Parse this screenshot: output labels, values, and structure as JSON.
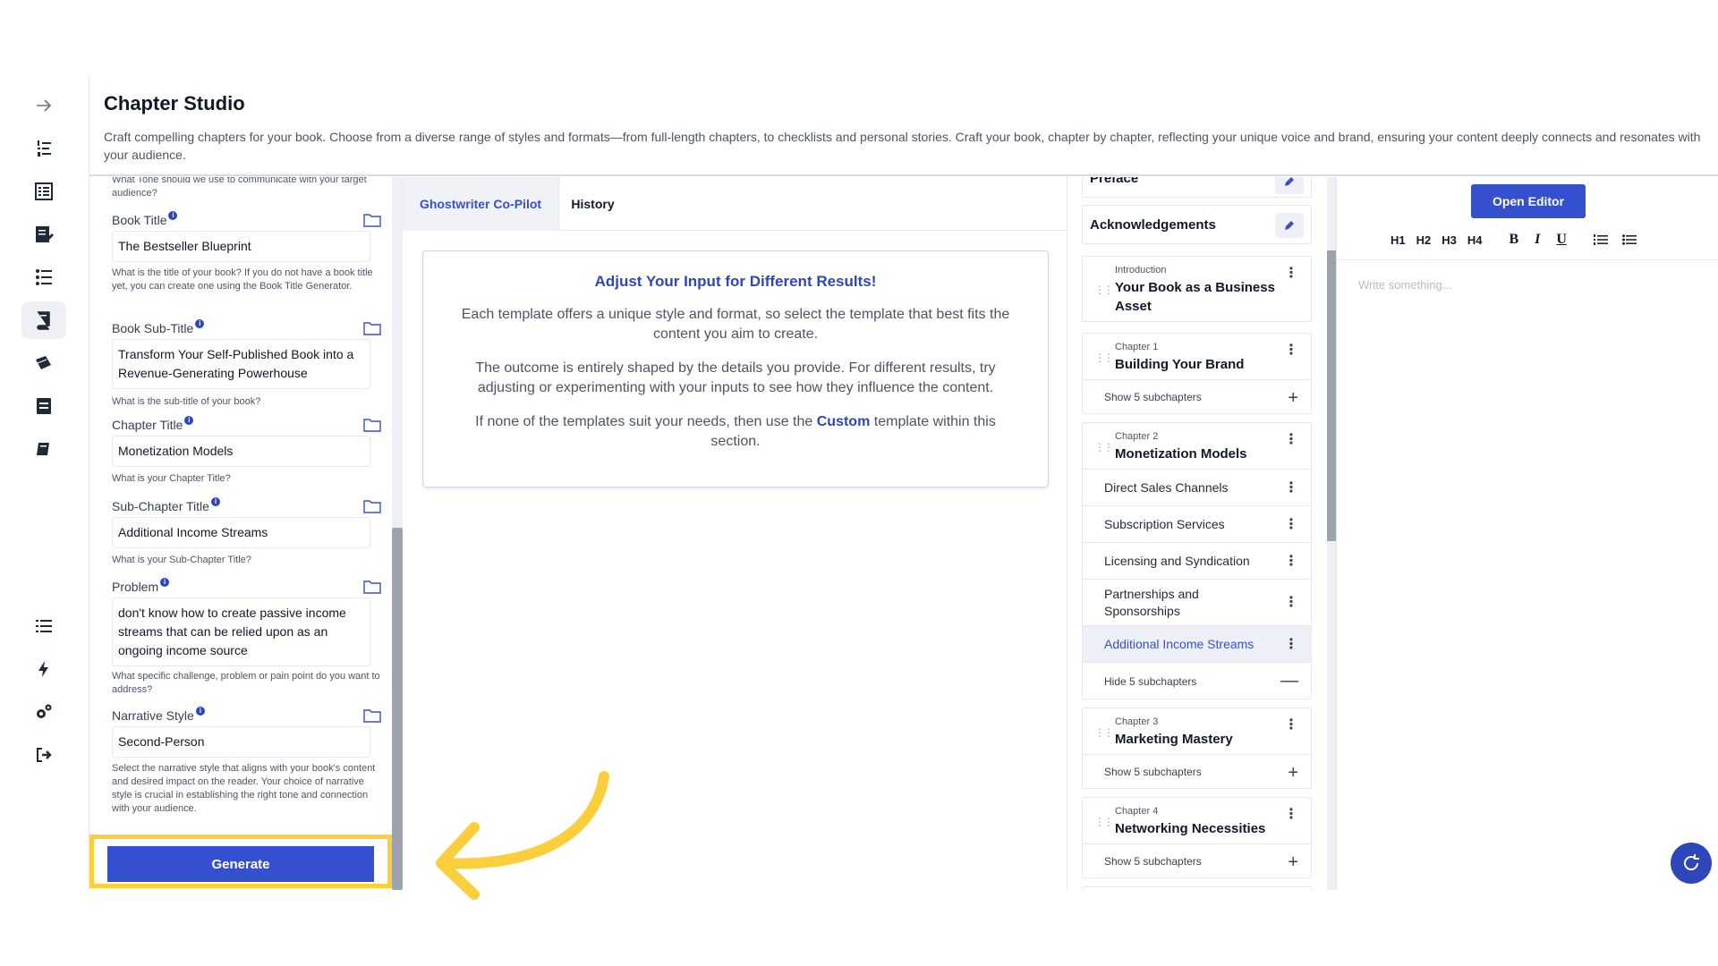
{
  "header": {
    "title": "Chapter Studio",
    "description": "Craft compelling chapters for your book. Choose from a diverse range of styles and formats—from full-length chapters, to checklists and personal stories. Craft your book, chapter by chapter, reflecting your unique voice and brand, ensuring your content deeply connects and resonates with your audience."
  },
  "form": {
    "top_hint": "What Tone should we use to communicate with your target audience?",
    "fields": [
      {
        "label": "Book Title",
        "value": "The Bestseller Blueprint",
        "help": "What is the title of your book? If you do not have a book title yet, you can create one using the Book Title Generator."
      },
      {
        "label": "Book Sub-Title",
        "value": "Transform Your Self-Published Book into a Revenue-Generating Powerhouse",
        "help": "What is the sub-title of your book?"
      },
      {
        "label": "Chapter Title",
        "value": "Monetization Models",
        "help": "What is your Chapter Title?"
      },
      {
        "label": "Sub-Chapter Title",
        "value": "Additional Income Streams",
        "help": "What is your Sub-Chapter Title?"
      },
      {
        "label": "Problem",
        "value": "don't know how to create passive income streams that can be relied upon as an ongoing income source",
        "help": "What specific challenge, problem or pain point do you want to address?"
      },
      {
        "label": "Narrative Style",
        "value": "Second-Person",
        "help": "Select the narrative style that aligns with your book's content and desired impact on the reader. Your choice of narrative style is crucial in establishing the right tone and connection with your audience."
      }
    ],
    "generate_label": "Generate"
  },
  "tabs": [
    "Ghostwriter Co-Pilot",
    "History"
  ],
  "info_card": {
    "title": "Adjust Your Input for Different Results!",
    "p1": "Each template offers a unique style and format, so select the template that best fits the content you aim to create.",
    "p2": "The outcome is entirely shaped by the details you provide. For different results, try adjusting or experimenting with your inputs to see how they influence the content.",
    "p3_before": "If none of the templates suit your needs, then use the",
    "p3_link": "Custom",
    "p3_after": "template within this section."
  },
  "chapters": {
    "preface": "Preface",
    "acknowledgements": "Acknowledgements",
    "intro": {
      "tag": "Introduction",
      "title": "Your Book as a Business Asset"
    },
    "ch1": {
      "tag": "Chapter 1",
      "title": "Building Your Brand",
      "show": "Show 5 subchapters"
    },
    "ch2": {
      "tag": "Chapter 2",
      "title": "Monetization Models",
      "hide": "Hide 5 subchapters",
      "subs": [
        "Direct Sales Channels",
        "Subscription Services",
        "Licensing and Syndication",
        "Partnerships and Sponsorships",
        "Additional Income Streams"
      ]
    },
    "ch3": {
      "tag": "Chapter 3",
      "title": "Marketing Mastery",
      "show": "Show 5 subchapters"
    },
    "ch4": {
      "tag": "Chapter 4",
      "title": "Networking Necessities",
      "show": "Show 5 subchapters"
    }
  },
  "editor": {
    "open_label": "Open Editor",
    "toolbar": [
      "H1",
      "H2",
      "H3",
      "H4",
      "B",
      "I",
      "U"
    ],
    "placeholder": "Write something..."
  },
  "colors": {
    "accent": "#3550cf",
    "highlight": "#fbcf3b"
  }
}
